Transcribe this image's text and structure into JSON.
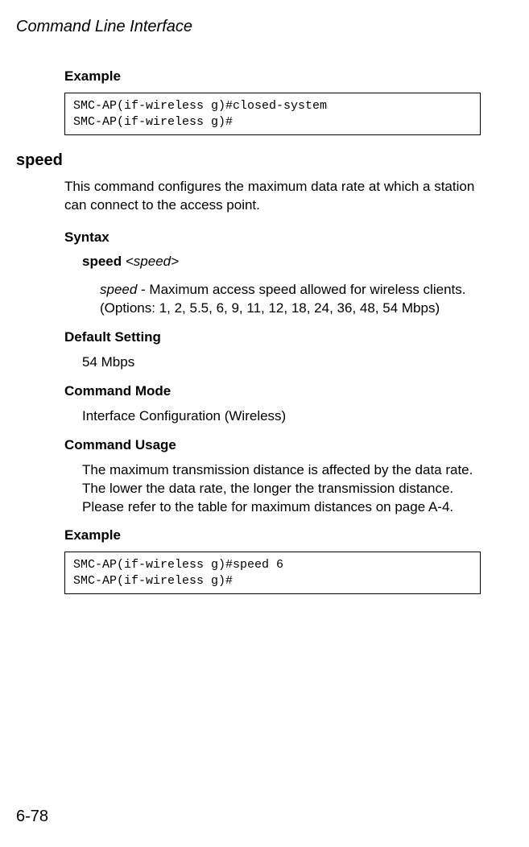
{
  "page_header": "Command Line Interface",
  "example1": {
    "heading": "Example",
    "code": "SMC-AP(if-wireless g)#closed-system\nSMC-AP(if-wireless g)#"
  },
  "command_name": "speed",
  "command_desc": "This command configures the maximum data rate at which a station can connect to the access point.",
  "syntax": {
    "heading": "Syntax",
    "keyword": "speed",
    "param": "<speed>",
    "param_name": "speed",
    "param_desc_rest": " - Maximum access speed allowed for wireless clients. (Options: 1, 2, 5.5, 6, 9, 11, 12, 18, 24, 36, 48, 54 Mbps)"
  },
  "default_setting": {
    "heading": "Default Setting",
    "value": "54 Mbps"
  },
  "command_mode": {
    "heading": "Command Mode",
    "value": "Interface Configuration (Wireless)"
  },
  "command_usage": {
    "heading": "Command Usage",
    "value": "The maximum transmission distance is affected by the data rate. The lower the data rate, the longer the transmission distance. Please refer to the table for maximum distances on page A-4."
  },
  "example2": {
    "heading": "Example",
    "code": "SMC-AP(if-wireless g)#speed 6\nSMC-AP(if-wireless g)#"
  },
  "page_number": "6-78"
}
